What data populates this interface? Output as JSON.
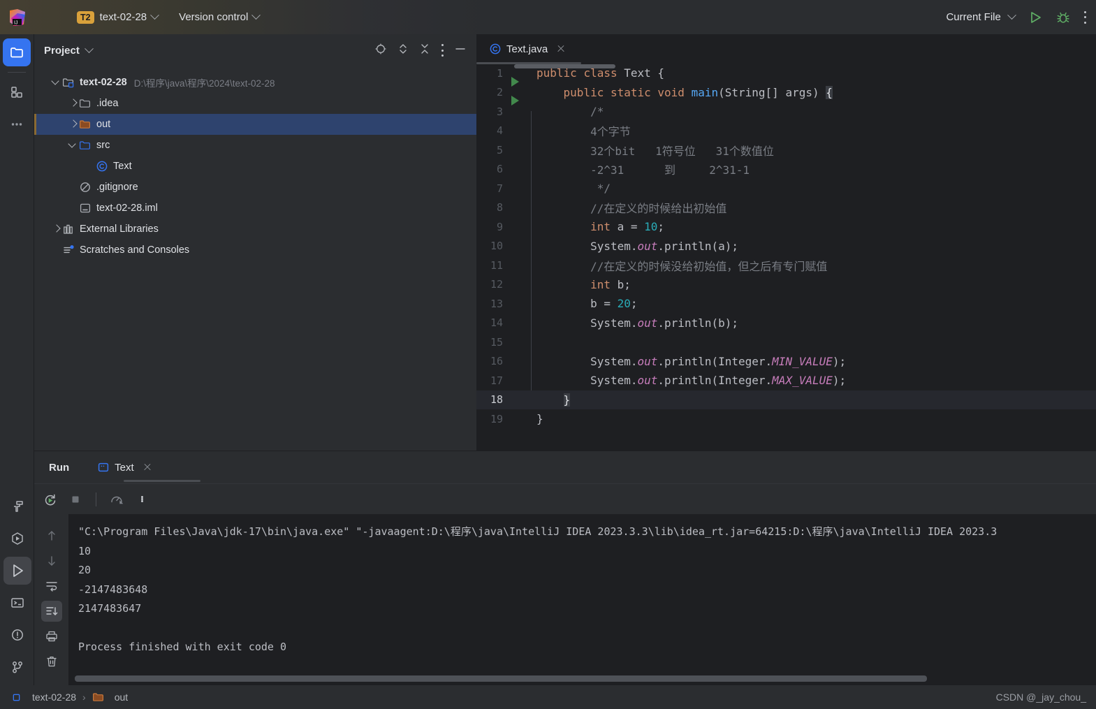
{
  "titlebar": {
    "logo_icon": "intellij-idea-logo",
    "menu_icon": "hamburger-menu-icon",
    "project_badge": "T2",
    "project_name": "text-02-28",
    "vcs_label": "Version control",
    "run_config": "Current File",
    "run_icon": "run-play-icon",
    "debug_icon": "debug-bug-icon",
    "more_icon": "more-vertical-icon"
  },
  "stripe": {
    "top": [
      {
        "name": "project-tool-window",
        "icon": "folder-icon",
        "active": true
      },
      {
        "name": "structure-tool-window",
        "icon": "structure-squares-icon",
        "active": false
      },
      {
        "name": "more-tool-windows",
        "icon": "ellipsis-icon",
        "active": false
      }
    ],
    "bottom": [
      {
        "name": "build-tool-window",
        "icon": "hammer-icon",
        "active": false
      },
      {
        "name": "run-anything",
        "icon": "hexagon-play-icon",
        "active": false
      },
      {
        "name": "run-tool-window",
        "icon": "play-icon",
        "active": true
      },
      {
        "name": "terminal-tool-window",
        "icon": "terminal-icon",
        "active": false
      },
      {
        "name": "problems-tool-window",
        "icon": "exclamation-circle-icon",
        "active": false
      },
      {
        "name": "git-tool-window",
        "icon": "git-branch-icon",
        "active": false
      }
    ]
  },
  "project_panel": {
    "title": "Project",
    "tools": [
      {
        "name": "locate-icon"
      },
      {
        "name": "expand-collapse-icon"
      },
      {
        "name": "collapse-all-icon"
      },
      {
        "name": "options-more-icon"
      },
      {
        "name": "minimize-icon"
      }
    ],
    "tree": [
      {
        "label": "text-02-28",
        "sub": "D:\\程序\\java\\程序\\2024\\text-02-28",
        "icon": "project-folder-icon",
        "arrow": "down",
        "indent": 0,
        "bold": true,
        "selected": false
      },
      {
        "label": ".idea",
        "sub": "",
        "icon": "folder-grey-icon",
        "arrow": "right",
        "indent": 1,
        "bold": false,
        "selected": false
      },
      {
        "label": "out",
        "sub": "",
        "icon": "folder-orange-icon",
        "arrow": "right",
        "indent": 1,
        "bold": false,
        "selected": true
      },
      {
        "label": "src",
        "sub": "",
        "icon": "folder-blue-icon",
        "arrow": "down",
        "indent": 1,
        "bold": false,
        "selected": false
      },
      {
        "label": "Text",
        "sub": "",
        "icon": "java-class-icon",
        "arrow": "none",
        "indent": 2,
        "bold": false,
        "selected": false
      },
      {
        "label": ".gitignore",
        "sub": "",
        "icon": "gitignore-icon",
        "arrow": "none",
        "indent": 1,
        "bold": false,
        "selected": false
      },
      {
        "label": "text-02-28.iml",
        "sub": "",
        "icon": "iml-file-icon",
        "arrow": "none",
        "indent": 1,
        "bold": false,
        "selected": false
      },
      {
        "label": "External Libraries",
        "sub": "",
        "icon": "libraries-icon",
        "arrow": "right",
        "indent": 0,
        "bold": false,
        "selected": false
      },
      {
        "label": "Scratches and Consoles",
        "sub": "",
        "icon": "scratches-icon",
        "arrow": "none",
        "indent": 0,
        "bold": false,
        "selected": false
      }
    ]
  },
  "editor": {
    "tab": {
      "label": "Text.java",
      "icon": "java-class-icon",
      "close_icon": "close-icon"
    },
    "lines": [
      {
        "n": "1",
        "run": true,
        "bar": false,
        "indent": 0,
        "tokens": [
          {
            "t": "public",
            "c": "kw"
          },
          {
            "t": " ",
            "c": "txt"
          },
          {
            "t": "class",
            "c": "kw"
          },
          {
            "t": " ",
            "c": "txt"
          },
          {
            "t": "Text",
            "c": "cls"
          },
          {
            "t": " {",
            "c": "txt"
          }
        ]
      },
      {
        "n": "2",
        "run": true,
        "bar": false,
        "indent": 4,
        "tokens": [
          {
            "t": "public",
            "c": "kw"
          },
          {
            "t": " ",
            "c": "txt"
          },
          {
            "t": "static",
            "c": "kw"
          },
          {
            "t": " ",
            "c": "txt"
          },
          {
            "t": "void",
            "c": "kw"
          },
          {
            "t": " ",
            "c": "txt"
          },
          {
            "t": "main",
            "c": "fn"
          },
          {
            "t": "(String[] args) ",
            "c": "txt"
          },
          {
            "t": "{",
            "c": "brace-hl"
          }
        ]
      },
      {
        "n": "3",
        "run": false,
        "bar": true,
        "indent": 8,
        "tokens": [
          {
            "t": "/*",
            "c": "cmt"
          }
        ]
      },
      {
        "n": "4",
        "run": false,
        "bar": true,
        "indent": 8,
        "tokens": [
          {
            "t": "4个字节",
            "c": "cmt"
          }
        ]
      },
      {
        "n": "5",
        "run": false,
        "bar": true,
        "indent": 8,
        "tokens": [
          {
            "t": "32个bit   1符号位   31个数值位",
            "c": "cmt"
          }
        ]
      },
      {
        "n": "6",
        "run": false,
        "bar": true,
        "indent": 8,
        "tokens": [
          {
            "t": "-2^31      到     2^31-1",
            "c": "cmt"
          }
        ]
      },
      {
        "n": "7",
        "run": false,
        "bar": true,
        "indent": 8,
        "tokens": [
          {
            "t": " */",
            "c": "cmt"
          }
        ]
      },
      {
        "n": "8",
        "run": false,
        "bar": true,
        "indent": 8,
        "tokens": [
          {
            "t": "//在定义的时候给出初始值",
            "c": "cmt"
          }
        ]
      },
      {
        "n": "9",
        "run": false,
        "bar": true,
        "indent": 8,
        "tokens": [
          {
            "t": "int",
            "c": "kw"
          },
          {
            "t": " a = ",
            "c": "txt"
          },
          {
            "t": "10",
            "c": "num"
          },
          {
            "t": ";",
            "c": "txt"
          }
        ]
      },
      {
        "n": "10",
        "run": false,
        "bar": true,
        "indent": 8,
        "tokens": [
          {
            "t": "System.",
            "c": "txt"
          },
          {
            "t": "out",
            "c": "stat"
          },
          {
            "t": ".println(a);",
            "c": "txt"
          }
        ]
      },
      {
        "n": "11",
        "run": false,
        "bar": true,
        "indent": 8,
        "tokens": [
          {
            "t": "//在定义的时候没给初始值，但之后有专门赋值",
            "c": "cmt"
          }
        ]
      },
      {
        "n": "12",
        "run": false,
        "bar": true,
        "indent": 8,
        "tokens": [
          {
            "t": "int",
            "c": "kw"
          },
          {
            "t": " b;",
            "c": "txt"
          }
        ]
      },
      {
        "n": "13",
        "run": false,
        "bar": true,
        "indent": 8,
        "tokens": [
          {
            "t": "b = ",
            "c": "txt"
          },
          {
            "t": "20",
            "c": "num"
          },
          {
            "t": ";",
            "c": "txt"
          }
        ]
      },
      {
        "n": "14",
        "run": false,
        "bar": true,
        "indent": 8,
        "tokens": [
          {
            "t": "System.",
            "c": "txt"
          },
          {
            "t": "out",
            "c": "stat"
          },
          {
            "t": ".println(b);",
            "c": "txt"
          }
        ]
      },
      {
        "n": "15",
        "run": false,
        "bar": true,
        "indent": 8,
        "tokens": []
      },
      {
        "n": "16",
        "run": false,
        "bar": true,
        "indent": 8,
        "tokens": [
          {
            "t": "System.",
            "c": "txt"
          },
          {
            "t": "out",
            "c": "stat"
          },
          {
            "t": ".println(Integer.",
            "c": "txt"
          },
          {
            "t": "MIN_VALUE",
            "c": "stat"
          },
          {
            "t": ");",
            "c": "txt"
          }
        ]
      },
      {
        "n": "17",
        "run": false,
        "bar": true,
        "indent": 8,
        "tokens": [
          {
            "t": "System.",
            "c": "txt"
          },
          {
            "t": "out",
            "c": "stat"
          },
          {
            "t": ".println(Integer.",
            "c": "txt"
          },
          {
            "t": "MAX_VALUE",
            "c": "stat"
          },
          {
            "t": ");",
            "c": "txt"
          }
        ]
      },
      {
        "n": "18",
        "run": false,
        "bar": false,
        "indent": 4,
        "current": true,
        "tokens": [
          {
            "t": "}",
            "c": "brace-hl"
          }
        ]
      },
      {
        "n": "19",
        "run": false,
        "bar": false,
        "indent": 0,
        "tokens": [
          {
            "t": "}",
            "c": "txt"
          }
        ]
      }
    ]
  },
  "run_panel": {
    "title": "Run",
    "tab": {
      "label": "Text",
      "icon": "run-config-icon",
      "close_icon": "close-icon"
    },
    "toolbar": [
      {
        "name": "rerun-button",
        "icon": "rerun-icon"
      },
      {
        "name": "stop-button",
        "icon": "stop-square-icon"
      },
      {
        "name": "profiler-button",
        "icon": "gauge-icon"
      },
      {
        "name": "more-options-button",
        "icon": "more-vertical-icon"
      }
    ],
    "side_toolbar": [
      {
        "name": "prev-occurrence-button",
        "icon": "arrow-up-icon",
        "active": false
      },
      {
        "name": "next-occurrence-button",
        "icon": "arrow-down-icon",
        "active": false
      },
      {
        "name": "soft-wrap-button",
        "icon": "soft-wrap-icon",
        "active": false
      },
      {
        "name": "scroll-to-end-button",
        "icon": "scroll-to-end-icon",
        "active": true
      },
      {
        "name": "print-button",
        "icon": "printer-icon",
        "active": false
      },
      {
        "name": "clear-all-button",
        "icon": "trash-icon",
        "active": false
      }
    ],
    "console": [
      "\"C:\\Program Files\\Java\\jdk-17\\bin\\java.exe\" \"-javaagent:D:\\程序\\java\\IntelliJ IDEA 2023.3.3\\lib\\idea_rt.jar=64215:D:\\程序\\java\\IntelliJ IDEA 2023.3",
      "10",
      "20",
      "-2147483648",
      "2147483647",
      "",
      "Process finished with exit code 0"
    ]
  },
  "status_bar": {
    "crumbs": [
      {
        "label": "text-02-28",
        "icon": "module-icon"
      },
      {
        "label": "out",
        "icon": "folder-orange-icon"
      }
    ],
    "separator": "›",
    "watermark": "CSDN @_jay_chou_"
  },
  "colors": {
    "accent_blue": "#3574f0",
    "selection_blue": "#2e436e",
    "badge_gold": "#d9a13b",
    "run_green": "#499c54",
    "panel_bg": "#2b2d30",
    "editor_bg": "#1e1f22",
    "keyword_orange": "#cf8e6d",
    "number_teal": "#2aacb8",
    "static_purple": "#c77dbb",
    "comment_grey": "#7a7e85",
    "method_blue": "#56a8f5"
  }
}
